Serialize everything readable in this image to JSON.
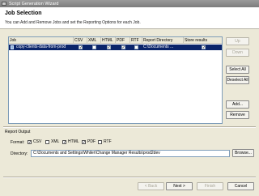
{
  "window": {
    "title": "Script Generation Wizard"
  },
  "banner": {
    "title": "Job Selection",
    "description": "You can Add and Remove Jobs and set the Reporting Options for each Job."
  },
  "table": {
    "columns": [
      "Job",
      "CSV",
      "XML",
      "HTML",
      "PDF",
      "RTF",
      "Report Directory",
      "Store results"
    ],
    "rows": [
      {
        "job": "copy-clients-data-from-prod",
        "csv": true,
        "xml": false,
        "html": true,
        "pdf": true,
        "rtf": false,
        "report_directory": "C:\\Documents ...",
        "store_results": true,
        "selected": true
      }
    ]
  },
  "side_buttons": {
    "up": "Up",
    "down": "Down",
    "select_all": "Select All",
    "deselect_all": "Deselect All",
    "add": "Add...",
    "remove": "Remove"
  },
  "report_output": {
    "label": "Report Output",
    "format_label": "Format:",
    "formats": [
      {
        "name": "CSV",
        "checked": true
      },
      {
        "name": "XML",
        "checked": false
      },
      {
        "name": "HTML",
        "checked": true
      },
      {
        "name": "PDF",
        "checked": true
      },
      {
        "name": "RTF",
        "checked": false
      }
    ],
    "directory_label": "Directory:",
    "directory_value": "C:\\Documents and Settings\\Whiler\\Change Manager Results\\prod2dev",
    "browse": "Browse..."
  },
  "footer": {
    "back": "< Back",
    "next": "Next >",
    "finish": "Finish",
    "cancel": "Cancel"
  },
  "check_glyph": "✓"
}
